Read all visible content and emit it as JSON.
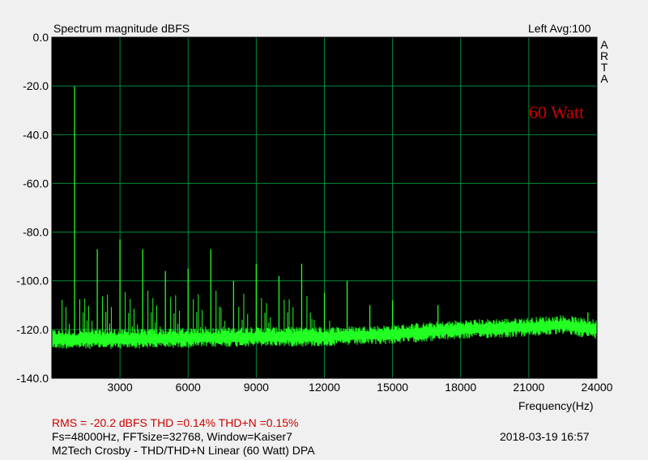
{
  "header": {
    "title": "Spectrum magnitude dBFS",
    "channel_avg": "Left  Avg:100",
    "brand_letters": [
      "A",
      "R",
      "T",
      "A"
    ]
  },
  "badge": {
    "text": "60 Watt",
    "color": "#cc0000"
  },
  "footer": {
    "rms_line": "RMS =  -20.2 dBFS   THD =0.14%   THD+N =0.15%",
    "params_line": "Fs=48000Hz, FFTsize=32768, Window=Kaiser7",
    "desc_line": "M2Tech Crosby - THD/THD+N Linear (60 Watt)     DPA",
    "datetime": "2018-03-19  16:57"
  },
  "colors": {
    "plot_bg": "#000000",
    "grid": "#008c3a",
    "trace": "#22ff22",
    "page_bg": "#f0f0f0",
    "accent_red": "#cc0000"
  },
  "chart_data": {
    "type": "line",
    "title": "Spectrum magnitude dBFS",
    "xlabel": "Frequency(Hz)",
    "ylabel": "",
    "xlim": [
      0,
      24000
    ],
    "ylim": [
      -140,
      0
    ],
    "x_ticks": [
      3000,
      6000,
      9000,
      12000,
      15000,
      18000,
      21000,
      24000
    ],
    "y_ticks": [
      0,
      -20,
      -40,
      -60,
      -80,
      -100,
      -120,
      -140
    ],
    "y_tick_labels": [
      "0.0",
      "-20.0",
      "-40.0",
      "-60.0",
      "-80.0",
      "-100.0",
      "-120.0",
      "-140.0"
    ],
    "grid": true,
    "noise_floor": [
      [
        0,
        -124
      ],
      [
        3000,
        -124
      ],
      [
        6000,
        -123.5
      ],
      [
        9000,
        -123
      ],
      [
        12000,
        -123
      ],
      [
        15000,
        -122
      ],
      [
        18000,
        -120
      ],
      [
        21000,
        -119
      ],
      [
        22500,
        -118
      ],
      [
        24000,
        -120
      ]
    ],
    "harmonics": [
      {
        "f": 1000,
        "db": -20.2
      },
      {
        "f": 2000,
        "db": -87
      },
      {
        "f": 3000,
        "db": -83
      },
      {
        "f": 4000,
        "db": -87
      },
      {
        "f": 5000,
        "db": -96
      },
      {
        "f": 6000,
        "db": -95
      },
      {
        "f": 7000,
        "db": -87
      },
      {
        "f": 8000,
        "db": -100
      },
      {
        "f": 9000,
        "db": -93
      },
      {
        "f": 10000,
        "db": -98
      },
      {
        "f": 11000,
        "db": -93
      },
      {
        "f": 12000,
        "db": -105
      },
      {
        "f": 13000,
        "db": -100
      },
      {
        "f": 14000,
        "db": -110
      },
      {
        "f": 15000,
        "db": -108
      },
      {
        "f": 17000,
        "db": -110
      },
      {
        "f": 23600,
        "db": -113
      }
    ]
  }
}
